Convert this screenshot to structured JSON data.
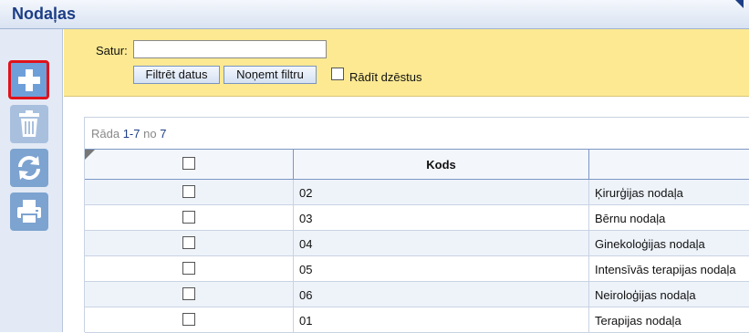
{
  "window": {
    "title": "Nodaļas"
  },
  "toolbar": {
    "buttons": [
      {
        "icon": "plus-icon",
        "name": "add-button"
      },
      {
        "icon": "trash-icon",
        "name": "delete-button"
      },
      {
        "icon": "refresh-icon",
        "name": "refresh-button"
      },
      {
        "icon": "printer-icon",
        "name": "print-button"
      }
    ]
  },
  "filter": {
    "label": "Satur:",
    "value": "",
    "placeholder": "",
    "filter_button": "Filtrēt datus",
    "clear_button": "Noņemt filtru",
    "show_deleted_label": "Rādīt dzēstus",
    "show_deleted_checked": false
  },
  "grid": {
    "info_prefix": "Rāda",
    "info_range": "1-7",
    "info_of": "no",
    "info_total": "7",
    "columns": [
      "",
      "Kods",
      ""
    ],
    "rows": [
      {
        "code": "02",
        "name": "Ķirurģijas nodaļa"
      },
      {
        "code": "03",
        "name": "Bērnu nodaļa"
      },
      {
        "code": "04",
        "name": "Ginekoloģijas nodaļa"
      },
      {
        "code": "05",
        "name": "Intensīvās terapijas nodaļa"
      },
      {
        "code": "06",
        "name": "Neiroloģijas nodaļa"
      },
      {
        "code": "01",
        "name": "Terapijas nodaļa"
      }
    ]
  },
  "colors": {
    "accent": "#1d3e86",
    "filter_bg": "#fce992",
    "highlight": "#e0121b"
  }
}
